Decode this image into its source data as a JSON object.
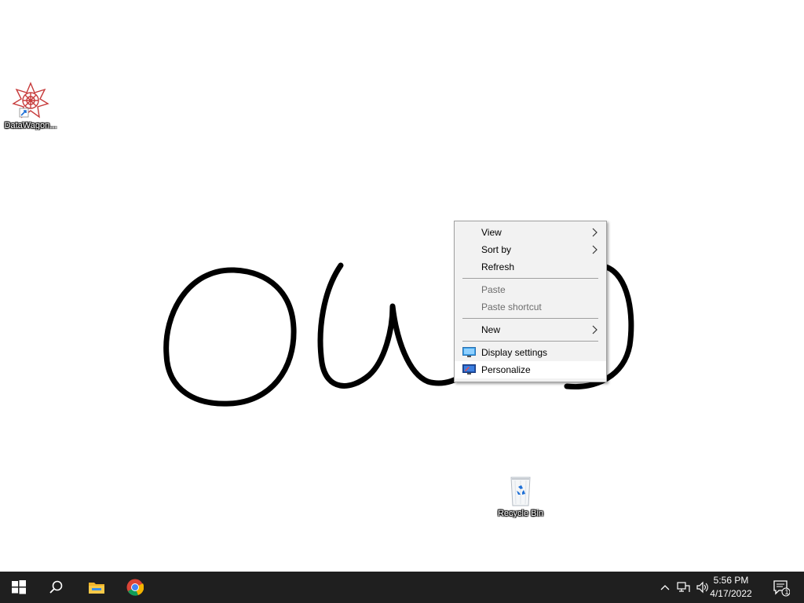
{
  "desktop": {
    "icons": [
      {
        "label": "DataWagon...",
        "icon": "datawagon-app-icon"
      },
      {
        "label": "Recycle Bin",
        "icon": "recycle-bin-icon"
      }
    ]
  },
  "context_menu": {
    "items": [
      {
        "label": "View",
        "submenu": true,
        "enabled": true
      },
      {
        "label": "Sort by",
        "submenu": true,
        "enabled": true
      },
      {
        "label": "Refresh",
        "submenu": false,
        "enabled": true
      },
      {
        "label": "Paste",
        "submenu": false,
        "enabled": false
      },
      {
        "label": "Paste shortcut",
        "submenu": false,
        "enabled": false
      },
      {
        "label": "New",
        "submenu": true,
        "enabled": true
      },
      {
        "label": "Display settings",
        "submenu": false,
        "enabled": true,
        "icon": "monitor-icon"
      },
      {
        "label": "Personalize",
        "submenu": false,
        "enabled": true,
        "icon": "personalize-icon",
        "hovered": true
      }
    ]
  },
  "taskbar": {
    "pinned": [
      "start-windows-icon",
      "search-icon",
      "file-explorer-icon",
      "chrome-icon"
    ],
    "tray": {
      "time": "5:56 PM",
      "date": "4/17/2022",
      "notification_count": "1"
    }
  },
  "colors": {
    "taskbar": "#1f1f1f",
    "menu_bg": "#f2f2f2",
    "menu_hover": "#ffffff",
    "disabled_text": "#6d6d6d"
  }
}
